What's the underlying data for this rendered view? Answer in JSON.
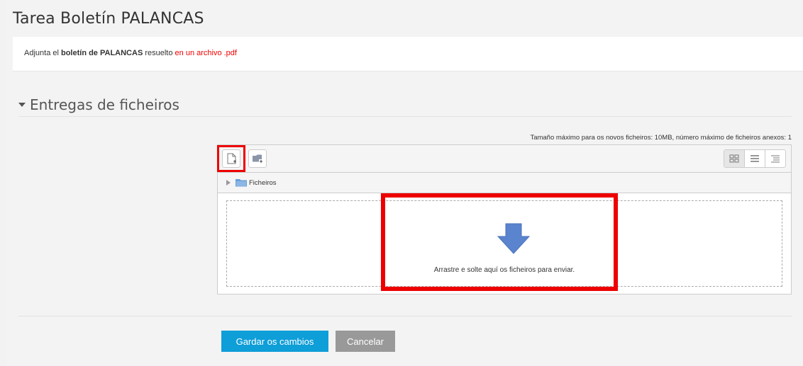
{
  "page": {
    "title": "Tarea Boletín PALANCAS"
  },
  "intro": {
    "prefix": "Adjunta el ",
    "bold": "boletín de PALANCAS",
    "middle": " resuelto ",
    "red": "en un archivo .pdf"
  },
  "section": {
    "title": "Entregas de ficheiros"
  },
  "filemanager": {
    "max_info": "Tamaño máximo para os novos ficheiros: 10MB, número máximo de ficheiros anexos: 1",
    "path_label": "Ficheiros",
    "drop_text": "Arrastre e solte aquí os ficheiros para enviar.",
    "icons": {
      "add_file": "add-file-icon",
      "create_folder": "create-folder-icon",
      "view_icons": "grid-view-icon",
      "view_list": "list-view-icon",
      "view_tree": "tree-view-icon",
      "folder": "folder-icon",
      "drop": "down-arrow-icon"
    }
  },
  "actions": {
    "save": "Gardar os cambios",
    "cancel": "Cancelar"
  },
  "colors": {
    "accent": "#0e9ed8",
    "highlight": "#ee0000",
    "cancel": "#999999",
    "folder": "#6a9fd8",
    "arrow": "#5b84cf"
  }
}
